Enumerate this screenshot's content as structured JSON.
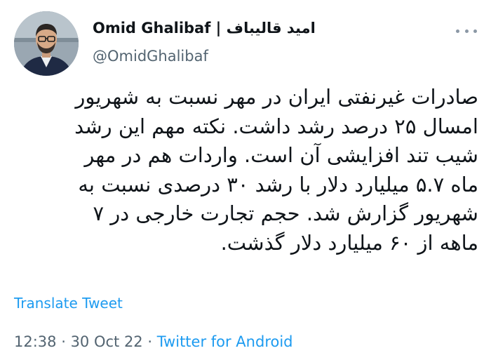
{
  "tweet": {
    "author": {
      "display_name": "Omid Ghalibaf | امید قالیباف",
      "handle": "@OmidGhalibaf"
    },
    "text_lines": [
      "صادرات غیرنفتی ایران در مهر نسبت به شهریور",
      "امسال ۲۵ درصد رشد داشت. نکته مهم این رشد",
      "شیب تند افزایشی آن است. واردات هم در مهر",
      "ماه ۵.۷ میلیارد دلار با رشد ۳۰ درصدی نسبت به",
      "شهریور گزارش شد. حجم تجارت خارجی در ۷",
      "ماهه از ۶۰ میلیارد دلار گذشت."
    ],
    "translate_label": "Translate Tweet",
    "time": "12:38",
    "separator": " · ",
    "date": "30 Oct 22",
    "source": "Twitter for Android",
    "more_icon": "more-horizontal-icon"
  },
  "colors": {
    "link": "#1d9bf0",
    "secondary_text": "#536471",
    "primary_text": "#0f1419"
  }
}
